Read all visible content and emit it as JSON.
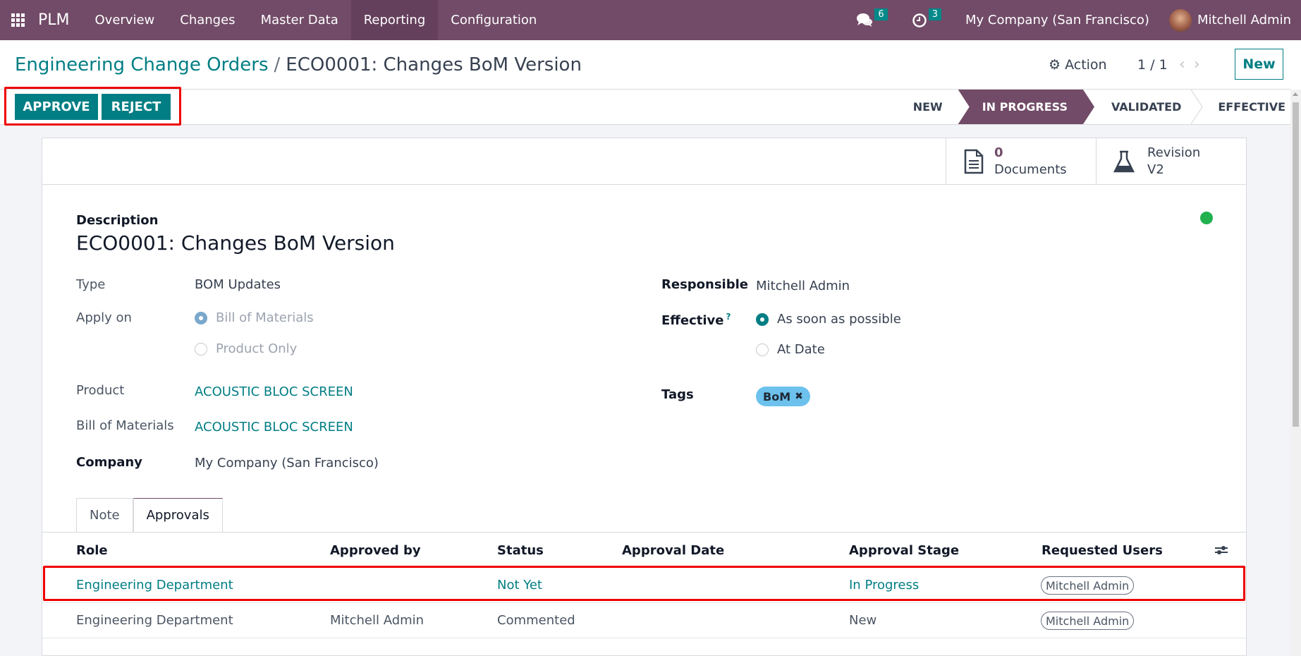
{
  "navbar": {
    "app_name": "PLM",
    "menu": [
      "Overview",
      "Changes",
      "Master Data",
      "Reporting",
      "Configuration"
    ],
    "active_menu": "Reporting",
    "messages_count": "6",
    "activities_count": "3",
    "company": "My Company (San Francisco)",
    "user": "Mitchell Admin"
  },
  "control_panel": {
    "breadcrumb_parent": "Engineering Change Orders",
    "breadcrumb_separator": "/",
    "breadcrumb_current": "ECO0001: Changes BoM Version",
    "action_label": "Action",
    "pager": "1 / 1",
    "new_label": "New"
  },
  "buttons": {
    "approve": "APPROVE",
    "reject": "REJECT"
  },
  "stages": [
    "NEW",
    "IN PROGRESS",
    "VALIDATED",
    "EFFECTIVE"
  ],
  "active_stage": "IN PROGRESS",
  "smart_buttons": {
    "documents_count": "0",
    "documents_label": "Documents",
    "revision_label": "Revision",
    "revision_value": "V2"
  },
  "form": {
    "description_label": "Description",
    "description": "ECO0001: Changes  BoM Version",
    "type_label": "Type",
    "type_value": "BOM Updates",
    "apply_on_label": "Apply on",
    "apply_on_options": [
      "Bill of Materials",
      "Product Only"
    ],
    "apply_on_selected": "Bill of Materials",
    "product_label": "Product",
    "product_value": "ACOUSTIC BLOC SCREEN",
    "bom_label": "Bill of Materials",
    "bom_value": "ACOUSTIC BLOC SCREEN",
    "company_label": "Company",
    "company_value": "My Company (San Francisco)",
    "responsible_label": "Responsible",
    "responsible_value": "Mitchell Admin",
    "effective_label": "Effective",
    "effective_help": "?",
    "effective_options": [
      "As soon as possible",
      "At Date"
    ],
    "effective_selected": "As soon as possible",
    "tags_label": "Tags",
    "tags": [
      "BoM"
    ],
    "status_color": "#21b14e"
  },
  "tabs": [
    "Note",
    "Approvals"
  ],
  "active_tab": "Approvals",
  "approvals": {
    "columns": [
      "Role",
      "Approved by",
      "Status",
      "Approval Date",
      "Approval Stage",
      "Requested Users"
    ],
    "rows": [
      {
        "role": "Engineering Department",
        "approved_by": "",
        "status": "Not Yet",
        "approval_date": "",
        "stage": "In Progress",
        "requested_users": "Mitchell Admin"
      },
      {
        "role": "Engineering Department",
        "approved_by": "Mitchell Admin",
        "status": "Commented",
        "approval_date": "",
        "stage": "New",
        "requested_users": "Mitchell Admin"
      }
    ]
  }
}
